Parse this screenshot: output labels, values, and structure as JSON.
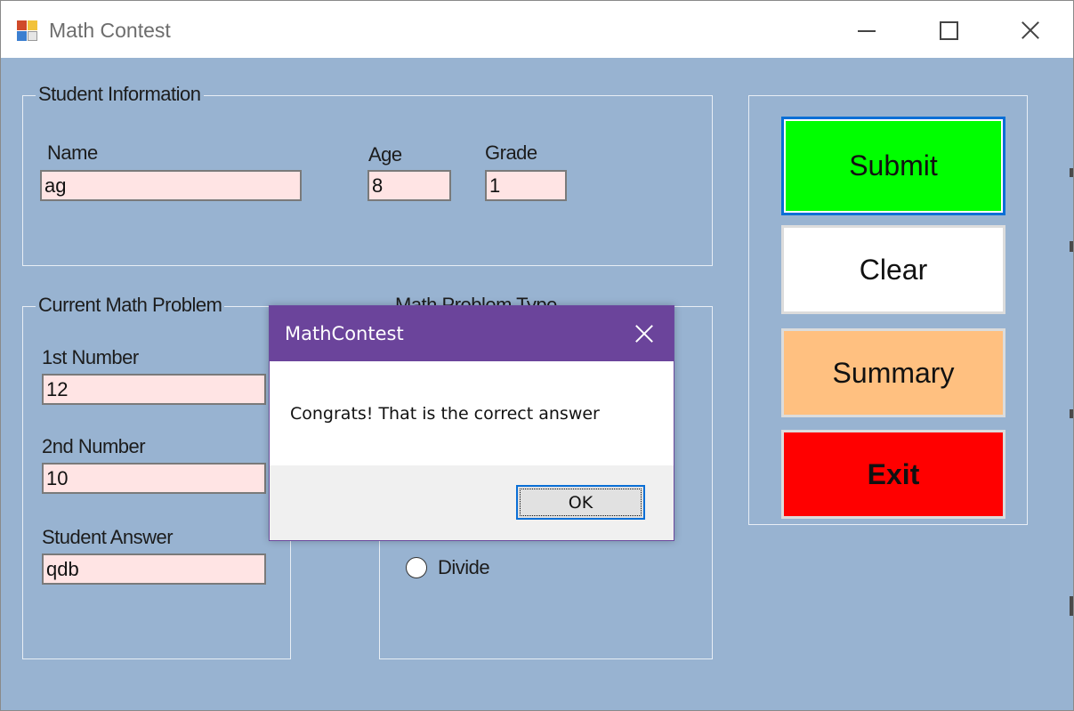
{
  "window": {
    "title": "Math Contest"
  },
  "student_info": {
    "legend": "Student Information",
    "name_label": "Name",
    "name_value": "ag",
    "age_label": "Age",
    "age_value": "8",
    "grade_label": "Grade",
    "grade_value": "1"
  },
  "current_problem": {
    "legend": "Current Math Problem",
    "first_label": "1st Number",
    "first_value": "12",
    "second_label": "2nd Number",
    "second_value": "10",
    "answer_label": "Student Answer",
    "answer_value": "qdb"
  },
  "problem_type": {
    "legend": "Math Problem Type",
    "visible_option": "Divide"
  },
  "buttons": {
    "submit": "Submit",
    "clear": "Clear",
    "summary": "Summary",
    "exit": "Exit"
  },
  "colors": {
    "form_background": "#98b3d1",
    "submit": "#00ff00",
    "clear": "#ffffff",
    "summary": "#ffc080",
    "exit": "#ff0000",
    "textbox": "#ffe4e4",
    "dialog_titlebar": "#6b449b"
  },
  "dialog": {
    "title": "MathContest",
    "message": "Congrats! That is the correct answer",
    "ok": "OK"
  },
  "icons": {
    "app": "app-icon",
    "minimize": "minimize-icon",
    "maximize": "maximize-icon",
    "close": "close-icon",
    "dialog_close": "close-icon"
  }
}
